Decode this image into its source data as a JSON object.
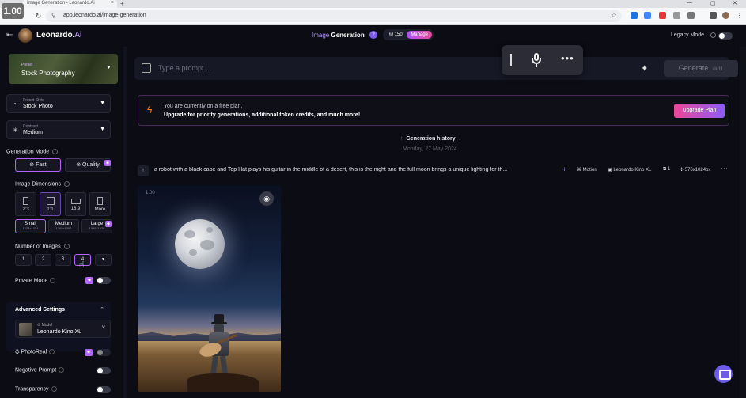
{
  "browser": {
    "tab_title": "Image Generation - Leonardo.Ai",
    "url": "app.leonardo.ai/image-generation",
    "zoom_badge": "1.00"
  },
  "header": {
    "brand": "Leonardo.",
    "brand_suffix": "Ai",
    "title_a": "Image",
    "title_b": "Generation",
    "credits": "150",
    "manage": "Manage",
    "legacy_mode": "Legacy Mode"
  },
  "sidebar": {
    "preset_label": "Preset",
    "preset_value": "Stock Photography",
    "preset_style_label": "Preset Style",
    "preset_style_value": "Stock Photo",
    "contrast_label": "Contrast",
    "contrast_value": "Medium",
    "generation_mode": "Generation Mode",
    "mode_fast": "Fast",
    "mode_quality": "Quality",
    "image_dimensions": "Image Dimensions",
    "dims": [
      "2:3",
      "1:1",
      "16:9",
      "More"
    ],
    "sizes": [
      {
        "label": "Small",
        "sub": "1024x1024"
      },
      {
        "label": "Medium",
        "sub": "1360x1360"
      },
      {
        "label": "Large",
        "sub": "1536x1536"
      }
    ],
    "number_of_images": "Number of Images",
    "nums": [
      "1",
      "2",
      "3",
      "4"
    ],
    "private_mode": "Private Mode",
    "advanced_settings": "Advanced Settings",
    "model_label": "Model",
    "model_value": "Leonardo Kino XL",
    "photoreal": "PhotoReal",
    "negative_prompt": "Negative Prompt",
    "transparency": "Transparency"
  },
  "main": {
    "prompt_placeholder": "Type a prompt ...",
    "generate": "Generate",
    "generate_cost": "11",
    "banner_line1": "You are currently on a free plan.",
    "banner_line2": "Upgrade for priority generations, additional token credits, and much more!",
    "upgrade": "Upgrade Plan",
    "history_title": "Generation history",
    "history_date": "Monday, 27 May 2024",
    "gen_prompt": "a robot with a black cape and Top Hat plays his guitar in the middle of a desert, this is the night and the full moon brings a unique lighting for th...",
    "meta_motion": "Motion",
    "meta_model": "Leonardo Kino XL",
    "meta_count": "1",
    "meta_size": "576x1024px",
    "image_zoom": "1.00"
  },
  "colors": {
    "accent": "#b565ff",
    "background": "#0b0c14",
    "upgrade_gradient_start": "#ec4899",
    "upgrade_gradient_end": "#8b5cf6"
  }
}
